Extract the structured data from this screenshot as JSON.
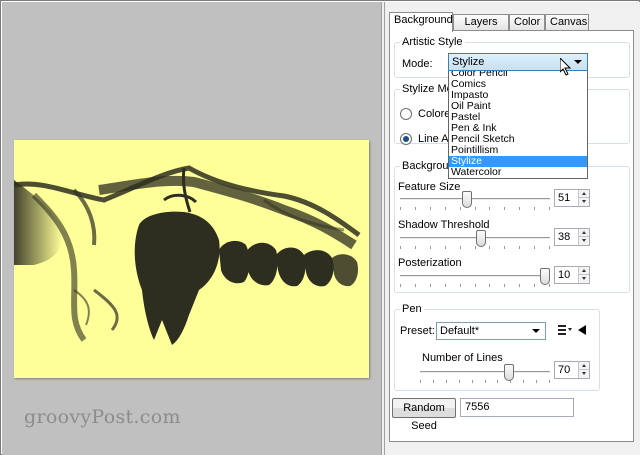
{
  "tabs": [
    {
      "label": "Background",
      "active": true
    },
    {
      "label": "Layers",
      "active": false
    },
    {
      "label": "Color",
      "active": false
    },
    {
      "label": "Canvas",
      "active": false
    }
  ],
  "artistic_style": {
    "title": "Artistic Style",
    "mode_label": "Mode:",
    "mode_value": "Stylize",
    "options": [
      "Color Pencil",
      "Comics",
      "Impasto",
      "Oil Paint",
      "Pastel",
      "Pen & Ink",
      "Pencil Sketch",
      "Pointillism",
      "Stylize",
      "Watercolor"
    ],
    "selected_option": "Stylize"
  },
  "stylize_mode": {
    "title": "Stylize Mode",
    "radios": [
      {
        "label": "Colored",
        "checked": false
      },
      {
        "label": "Line Art",
        "checked": true
      }
    ]
  },
  "background": {
    "title": "Background",
    "sliders": [
      {
        "label": "Feature Size",
        "value": "51",
        "fraction": 0.44
      },
      {
        "label": "Shadow Threshold",
        "value": "38",
        "fraction": 0.54
      },
      {
        "label": "Posterization",
        "value": "10",
        "fraction": 1.0
      }
    ]
  },
  "pen": {
    "title": "Pen",
    "preset_label": "Preset:",
    "preset_value": "Default*",
    "lines_label": "Number of Lines",
    "lines_value": "70",
    "lines_fraction": 0.7
  },
  "random_seed": {
    "button_label": "Random Seed",
    "value": "7556"
  },
  "watermark": "groovyPost.com",
  "colors": {
    "canvas_bg": "#ffff99",
    "ink": "#2e2e20",
    "selection": "#3399ff"
  }
}
